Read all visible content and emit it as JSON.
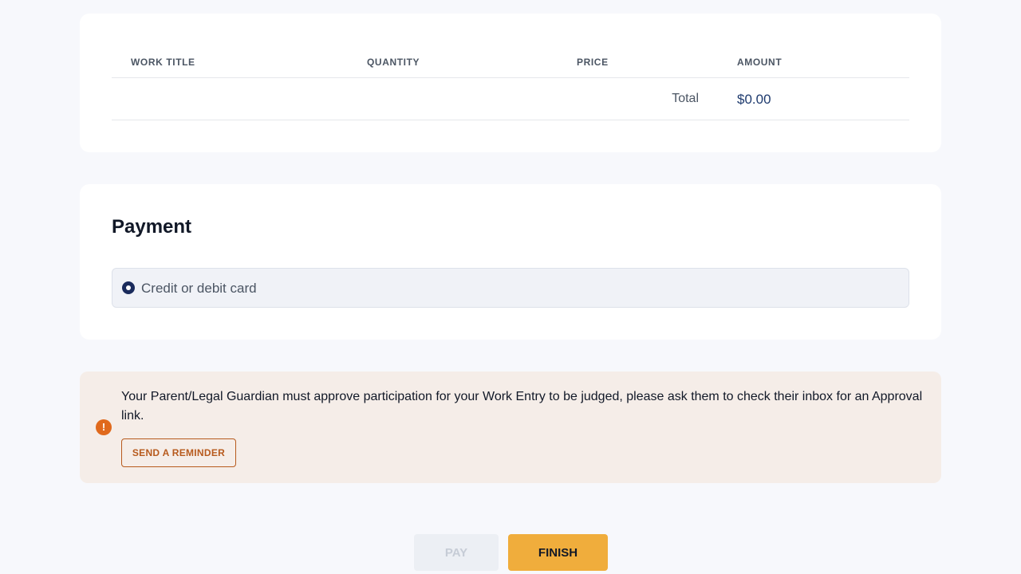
{
  "summary": {
    "columns": {
      "work_title": "WORK TITLE",
      "quantity": "QUANTITY",
      "price": "PRICE",
      "amount": "AMOUNT"
    },
    "total_label": "Total",
    "total_value": "$0.00"
  },
  "payment": {
    "title": "Payment",
    "selected_method": "Credit or debit card"
  },
  "alert": {
    "icon": "exclamation-icon",
    "message": "Your Parent/Legal Guardian must approve participation for your Work Entry to be judged, please ask them to check their inbox for an Approval link.",
    "reminder_label": "SEND A REMINDER"
  },
  "actions": {
    "pay_label": "PAY",
    "finish_label": "FINISH"
  },
  "colors": {
    "accent": "#f0ad3c",
    "alert_bg": "#f5ede8",
    "alert_accent": "#e0691c",
    "primary": "#1a2b5c"
  }
}
